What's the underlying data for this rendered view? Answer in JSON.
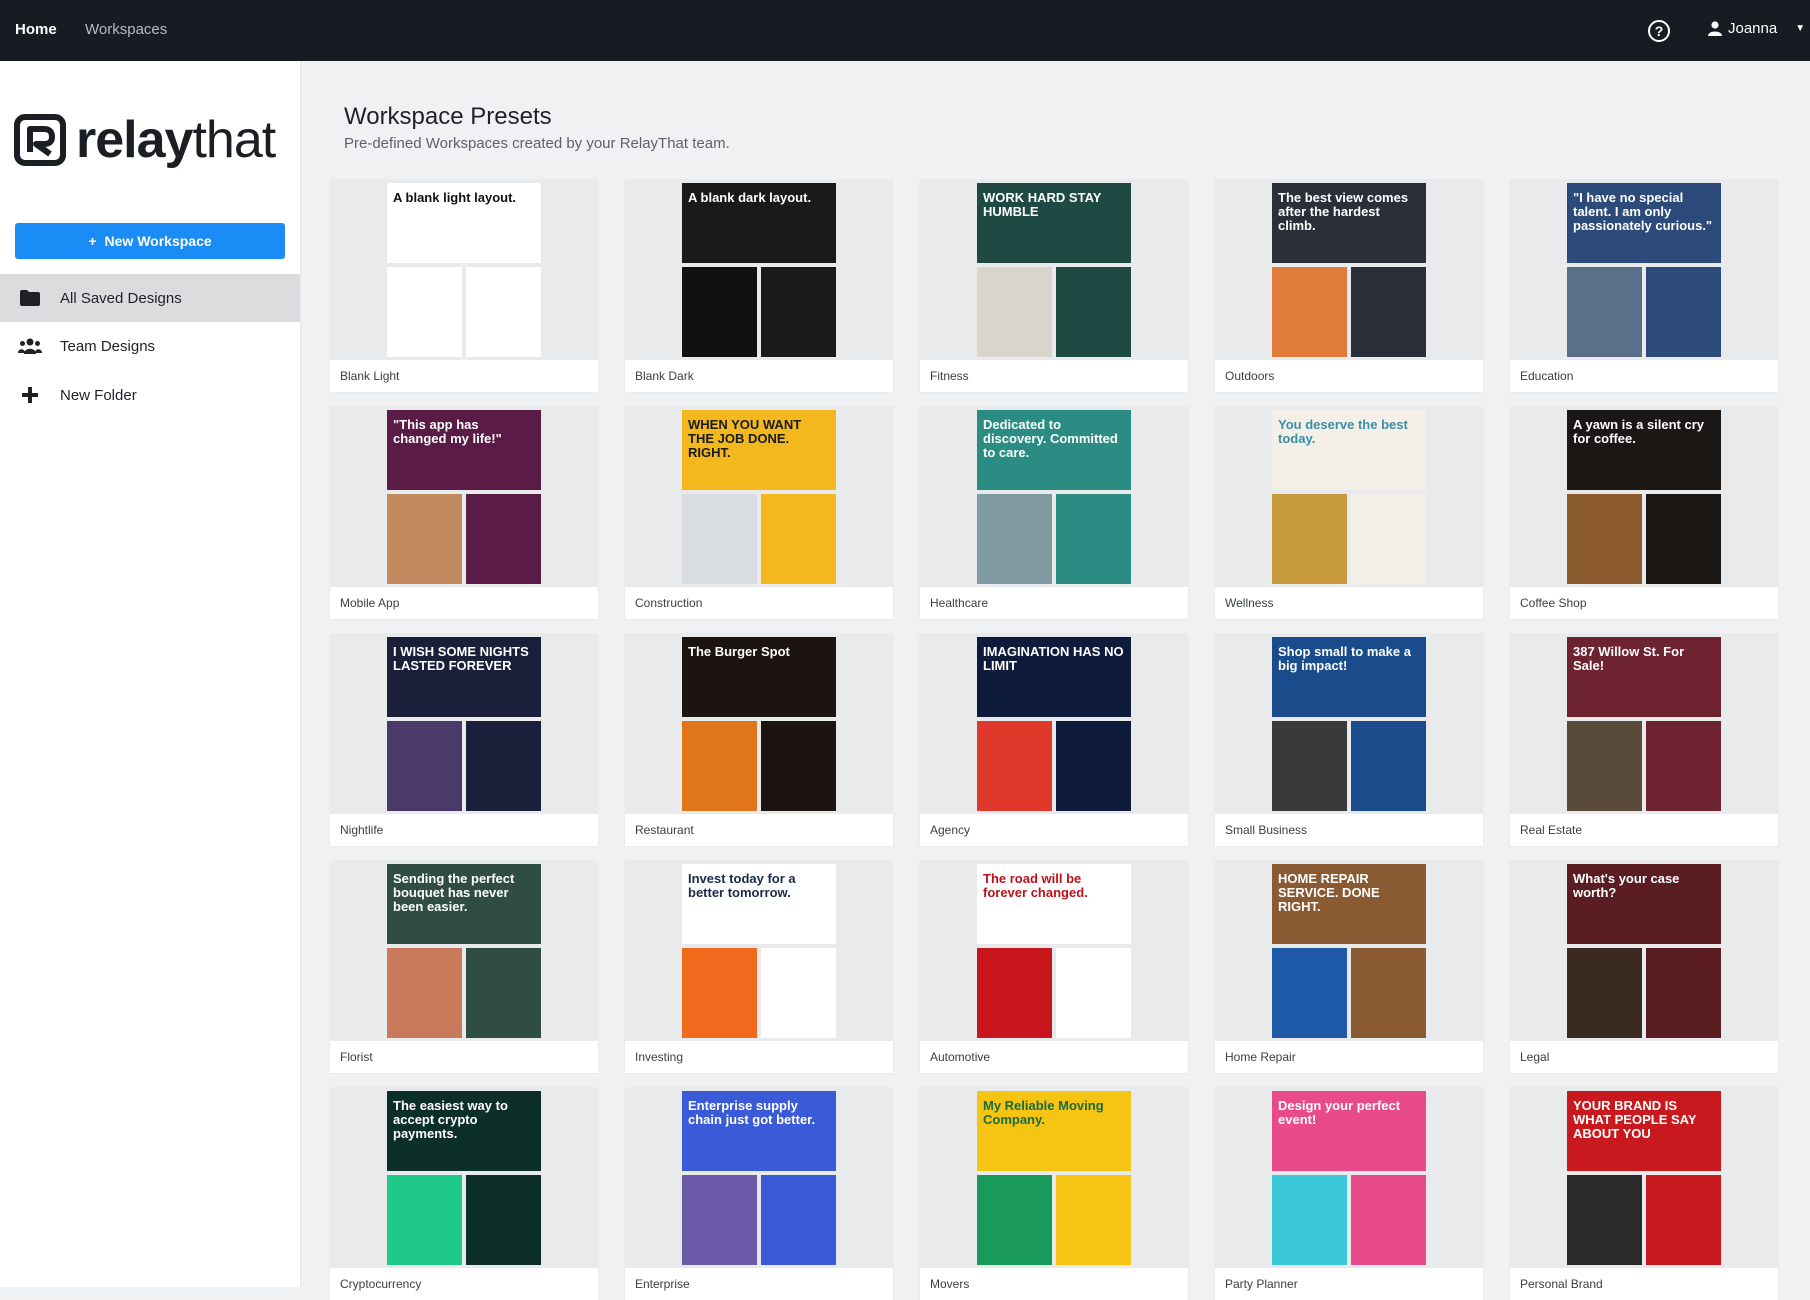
{
  "nav": {
    "home": "Home",
    "workspaces": "Workspaces",
    "help": "?",
    "user": "Joanna"
  },
  "logo": {
    "brand_bold": "relay",
    "brand_thin": "that"
  },
  "sidebar": {
    "new_workspace": "New Workspace",
    "items": [
      {
        "label": "All Saved Designs",
        "icon": "folder-icon"
      },
      {
        "label": "Team Designs",
        "icon": "team-icon"
      },
      {
        "label": "New Folder",
        "icon": "plus-icon"
      }
    ]
  },
  "page": {
    "title": "Workspace Presets",
    "subtitle": "Pre-defined Workspaces created by your RelayThat team."
  },
  "presets": [
    {
      "label": "Blank Light",
      "c1": "#ffffff",
      "c2": "#ffffff",
      "text": "A blank light layout.",
      "tc": "#111111"
    },
    {
      "label": "Blank Dark",
      "c1": "#1a1a1a",
      "c2": "#111111",
      "text": "A blank dark layout.",
      "tc": "#ffffff"
    },
    {
      "label": "Fitness",
      "c1": "#1f4a44",
      "c2": "#d9d4cc",
      "text": "WORK HARD STAY HUMBLE",
      "tc": "#ffffff"
    },
    {
      "label": "Outdoors",
      "c1": "#2b2f3a",
      "c2": "#e07b39",
      "text": "The best view comes after the hardest climb.",
      "tc": "#ffffff"
    },
    {
      "label": "Education",
      "c1": "#2c4a7a",
      "c2": "#5b6e8a",
      "text": "\"I have no special talent. I am only passionately curious.\"",
      "tc": "#ffffff"
    },
    {
      "label": "Mobile App",
      "c1": "#5a1c47",
      "c2": "#c08a5e",
      "text": "\"This app has changed my life!\"",
      "tc": "#ffffff"
    },
    {
      "label": "Construction",
      "c1": "#f2b81e",
      "c2": "#d9dde2",
      "text": "WHEN YOU WANT THE JOB DONE. RIGHT.",
      "tc": "#1a1a1a"
    },
    {
      "label": "Healthcare",
      "c1": "#2a8c83",
      "c2": "#7f9aa0",
      "text": "Dedicated to discovery. Committed to care.",
      "tc": "#ffffff"
    },
    {
      "label": "Wellness",
      "c1": "#f4f0e8",
      "c2": "#c69a3d",
      "text": "You deserve the best today.",
      "tc": "#3a8fa8"
    },
    {
      "label": "Coffee Shop",
      "c1": "#1b1714",
      "c2": "#8a5a2c",
      "text": "A yawn is a silent cry for coffee.",
      "tc": "#ffffff"
    },
    {
      "label": "Nightlife",
      "c1": "#1a1f3a",
      "c2": "#4a3a6a",
      "text": "I WISH SOME NIGHTS LASTED FOREVER",
      "tc": "#ffffff"
    },
    {
      "label": "Restaurant",
      "c1": "#1c1410",
      "c2": "#e0751c",
      "text": "The Burger Spot",
      "tc": "#ffffff"
    },
    {
      "label": "Agency",
      "c1": "#0f1b3a",
      "c2": "#e0392b",
      "text": "IMAGINATION HAS NO LIMIT",
      "tc": "#ffffff"
    },
    {
      "label": "Small Business",
      "c1": "#1a4c8c",
      "c2": "#3a3a3a",
      "text": "Shop small to make a big impact!",
      "tc": "#ffffff"
    },
    {
      "label": "Real Estate",
      "c1": "#6e2430",
      "c2": "#5a4a3a",
      "text": "387 Willow St. For Sale!",
      "tc": "#ffffff"
    },
    {
      "label": "Florist",
      "c1": "#2f4d45",
      "c2": "#c87a5a",
      "text": "Sending the perfect bouquet has never been easier.",
      "tc": "#ffffff"
    },
    {
      "label": "Investing",
      "c1": "#ffffff",
      "c2": "#f06a1e",
      "text": "Invest today for a better tomorrow.",
      "tc": "#1a2a4a"
    },
    {
      "label": "Automotive",
      "c1": "#ffffff",
      "c2": "#c8161c",
      "text": "The road will be forever changed.",
      "tc": "#b8121a"
    },
    {
      "label": "Home Repair",
      "c1": "#8a5a32",
      "c2": "#1e5aa8",
      "text": "HOME REPAIR SERVICE. DONE RIGHT.",
      "tc": "#ffffff"
    },
    {
      "label": "Legal",
      "c1": "#5a1e22",
      "c2": "#3a2a22",
      "text": "What's your case worth?",
      "tc": "#ffffff"
    },
    {
      "label": "Cryptocurrency",
      "c1": "#0d2f2a",
      "c2": "#1fc98a",
      "text": "The easiest way to accept crypto payments.",
      "tc": "#ffffff"
    },
    {
      "label": "Enterprise",
      "c1": "#3a5ad8",
      "c2": "#6a5aa8",
      "text": "Enterprise supply chain just got better.",
      "tc": "#ffffff"
    },
    {
      "label": "Movers",
      "c1": "#f6c514",
      "c2": "#1a9a5a",
      "text": "My Reliable Moving Company.",
      "tc": "#1a6a3a"
    },
    {
      "label": "Party Planner",
      "c1": "#e84a8a",
      "c2": "#3ac8d8",
      "text": "Design your perfect event!",
      "tc": "#ffffff"
    },
    {
      "label": "Personal Brand",
      "c1": "#c81a1e",
      "c2": "#2a2a2a",
      "text": "YOUR BRAND IS WHAT PEOPLE SAY ABOUT YOU",
      "tc": "#ffffff"
    }
  ]
}
